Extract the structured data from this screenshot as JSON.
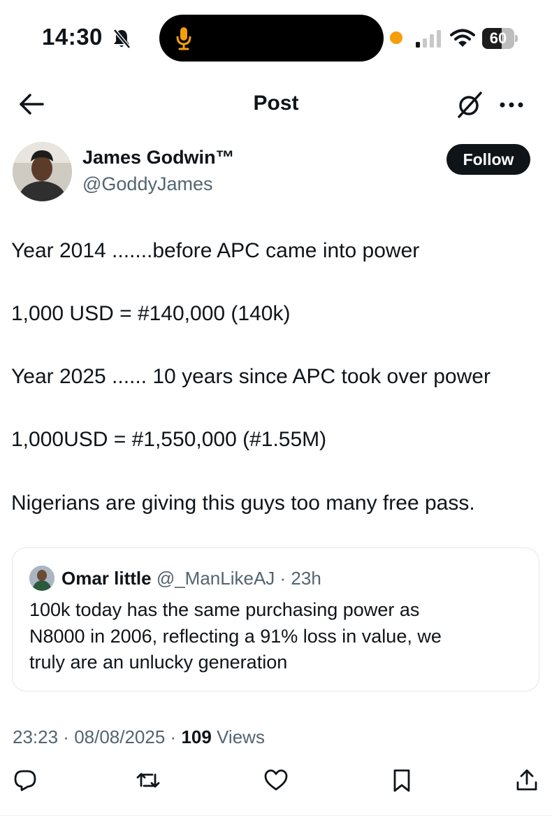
{
  "status_bar": {
    "time": "14:30",
    "battery": "60",
    "battery_level": 0.6
  },
  "header": {
    "title": "Post"
  },
  "author": {
    "name": "James Godwin™",
    "handle": "@GoddyJames",
    "follow_label": "Follow"
  },
  "post": {
    "lines": [
      "Year 2014  .......before APC came into power",
      "1,000 USD = #140,000 (140k)",
      "Year 2025 ...... 10 years since APC took over power",
      "1,000USD = #1,550,000 (#1.55M)",
      "Nigerians are giving this guys too many free pass."
    ]
  },
  "quote": {
    "name": "Omar little",
    "handle": "@_ManLikeAJ",
    "time": "23h",
    "lines": [
      "100k today has the same purchasing power as",
      "N8000 in 2006, reflecting a 91% loss in value, we",
      "truly are an unlucky generation"
    ]
  },
  "meta": {
    "time": "23:23",
    "date": "08/08/2025",
    "views_count": "109",
    "views_label": "Views",
    "separator": "·"
  },
  "icons": {
    "back": "back-arrow-icon",
    "grok": "grok-icon",
    "more": "more-icon",
    "reply": "reply-icon",
    "repost": "repost-icon",
    "like": "like-icon",
    "bookmark": "bookmark-icon",
    "share": "share-icon"
  },
  "colors": {
    "text": "#0f1419",
    "secondary": "#536471",
    "mic": "#f59e0b",
    "border": "#e1e8ed"
  }
}
